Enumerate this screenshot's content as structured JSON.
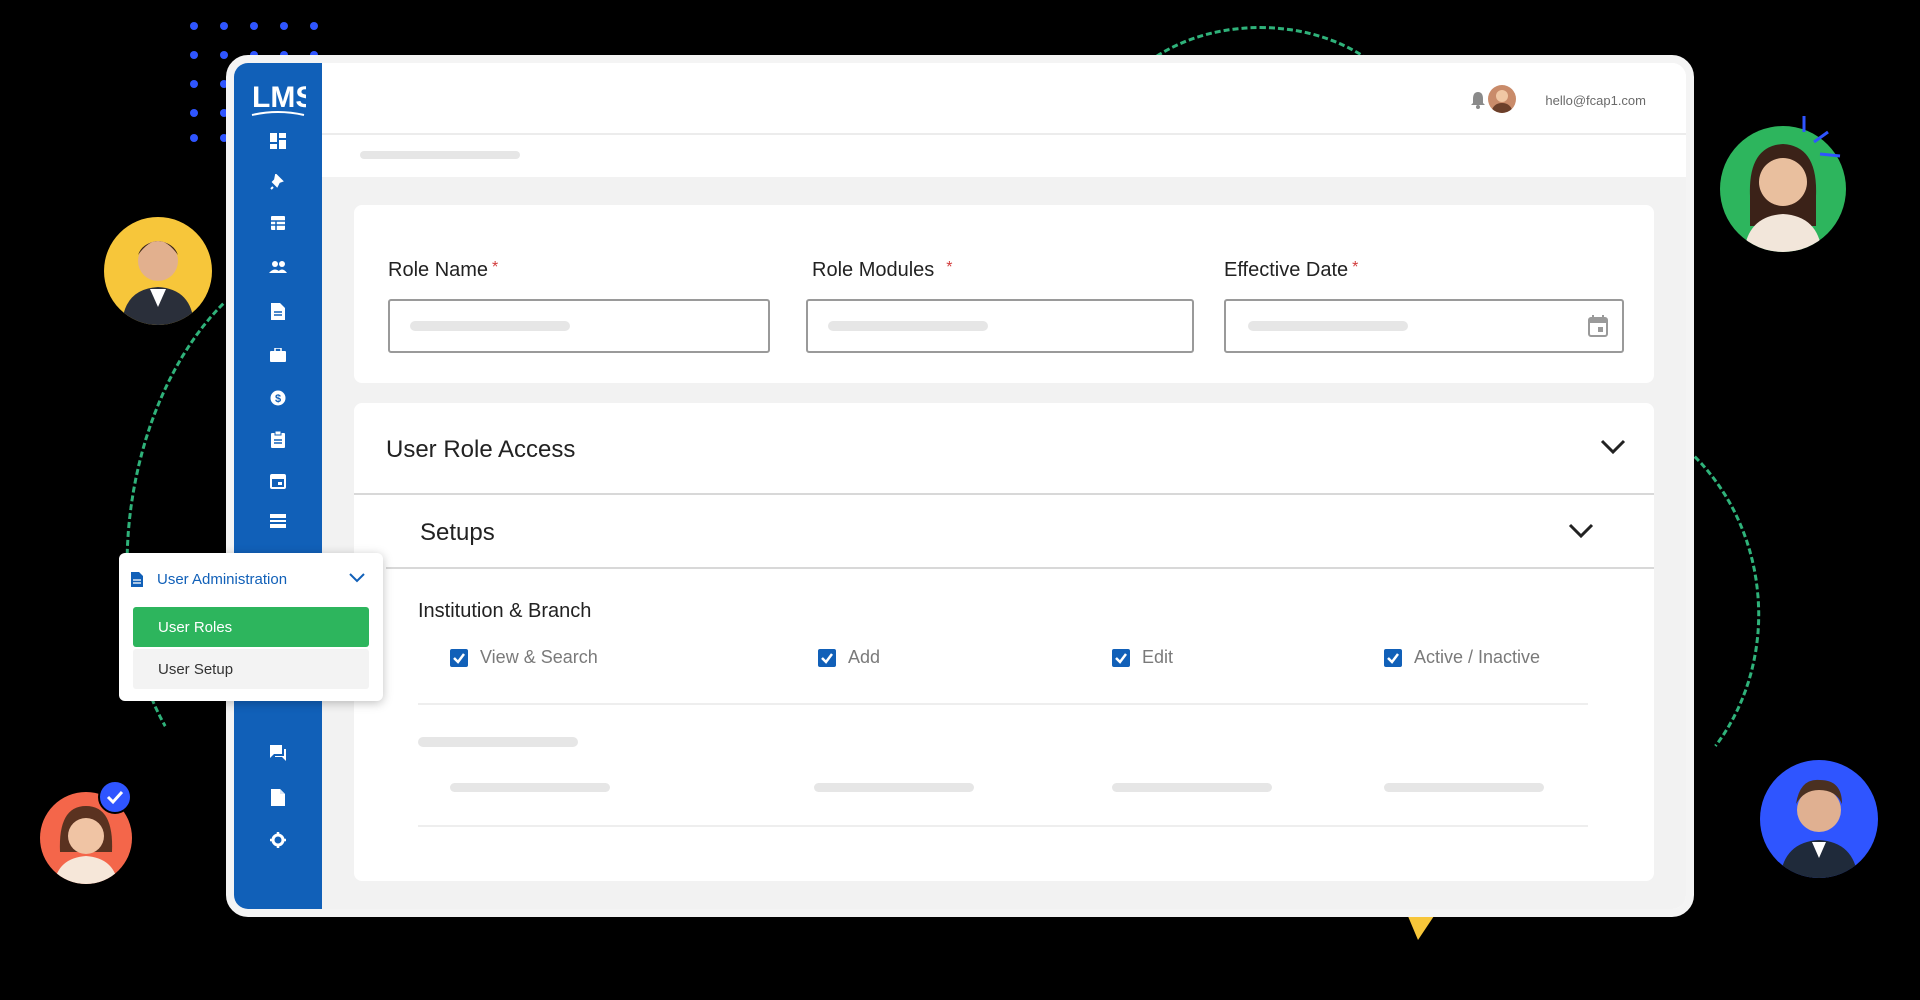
{
  "app": {
    "logo_text": "LMS",
    "user_email": "hello@fcap1.com"
  },
  "sidebar": {
    "icons": [
      "dashboard-icon",
      "pin-icon",
      "table-icon",
      "users-icon",
      "document-icon",
      "briefcase-icon",
      "dollar-icon",
      "clipboard-icon",
      "calendar-icon",
      "list-icon",
      "chat-icon",
      "file-icon",
      "settings-icon"
    ]
  },
  "submenu": {
    "title": "User Administration",
    "items": [
      {
        "label": "User Roles",
        "active": true
      },
      {
        "label": "User Setup",
        "active": false
      }
    ]
  },
  "form": {
    "fields": [
      {
        "label": "Role Name",
        "required_mark": "*"
      },
      {
        "label": "Role Modules",
        "required_mark": "*"
      },
      {
        "label": "Effective Date",
        "required_mark": "*"
      }
    ]
  },
  "access": {
    "title": "User Role Access",
    "section": "Setups",
    "group": "Institution & Branch",
    "permissions": [
      {
        "label": "View & Search",
        "checked": true
      },
      {
        "label": "Add",
        "checked": true
      },
      {
        "label": "Edit",
        "checked": true
      },
      {
        "label": "Active / Inactive",
        "checked": true
      }
    ]
  },
  "colors": {
    "primary": "#1160b8",
    "active_green": "#2db55d",
    "required": "#d23b3b",
    "accent_dashes": "#2fb27a"
  }
}
